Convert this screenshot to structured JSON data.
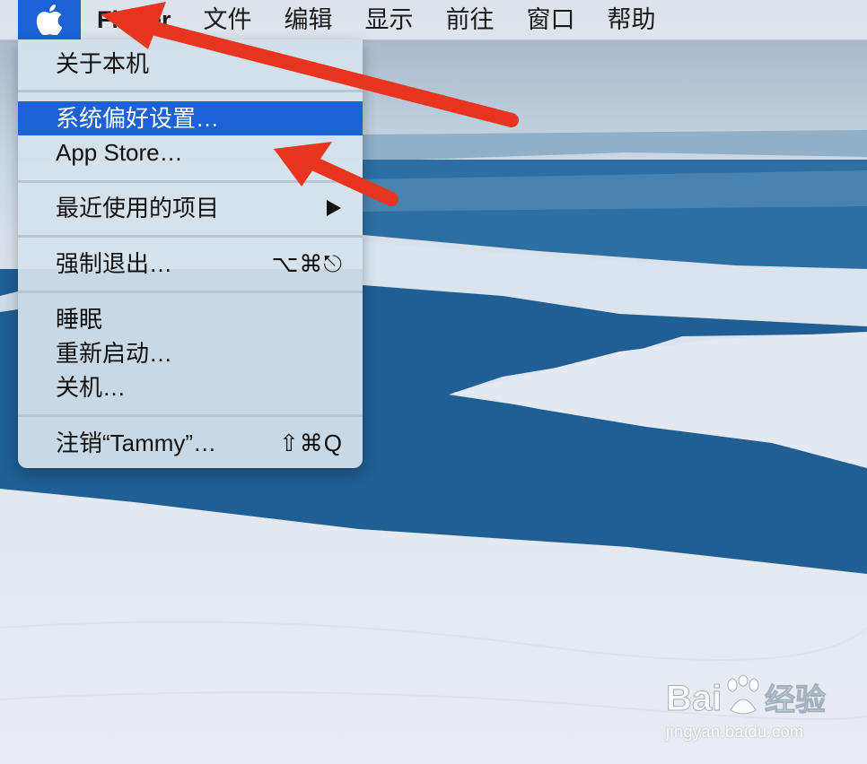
{
  "menubar": {
    "app_name": "Finder",
    "menus": [
      "文件",
      "编辑",
      "显示",
      "前往",
      "窗口",
      "帮助"
    ]
  },
  "apple_menu": {
    "items": [
      {
        "label": "关于本机",
        "shortcut": ""
      },
      {
        "label": "系统偏好设置…",
        "shortcut": "",
        "highlighted": true
      },
      {
        "label": "App Store…",
        "shortcut": ""
      },
      {
        "label": "最近使用的项目",
        "shortcut": "",
        "submenu": true
      },
      {
        "label": "强制退出…",
        "shortcut": "⌥⌘⎋"
      },
      {
        "label": "睡眠",
        "shortcut": ""
      },
      {
        "label": "重新启动…",
        "shortcut": ""
      },
      {
        "label": "关机…",
        "shortcut": ""
      },
      {
        "label": "注销“Tammy”…",
        "shortcut": "⇧⌘Q"
      }
    ]
  },
  "icons": {
    "apple": "apple-logo-icon",
    "submenu": "triangle-right-icon"
  },
  "watermark": {
    "brand": "Baidu经验",
    "url": "jingyan.baidu.com"
  },
  "colors": {
    "highlight": "#1c61d6",
    "arrow": "#e8351f",
    "sea": "#1f5f94"
  }
}
